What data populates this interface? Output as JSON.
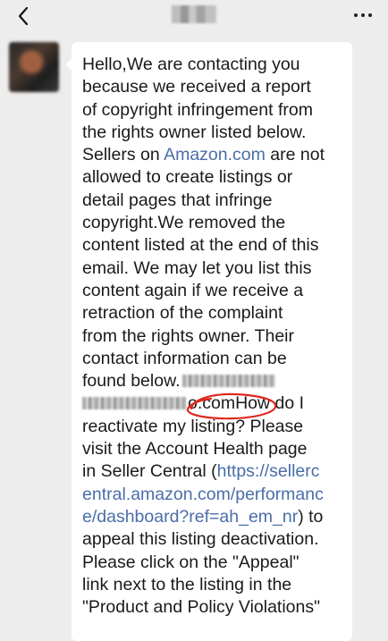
{
  "header": {
    "back_icon": "chevron-left-icon",
    "more_icon": "more-dots-icon"
  },
  "message": {
    "lines": [
      "Hello,We are contacting you",
      "because we received a report",
      "of copyright infringement from",
      "the rights owner listed below.",
      [
        "Sellers on ",
        "Amazon.com",
        " are not"
      ],
      " allowed to create listings or",
      "detail pages that infringe",
      "copyright.We removed the",
      "content listed at the end of this",
      " email. We may let you list this",
      "content again if we receive a",
      "retraction of the complaint",
      "from the rights owner. Their",
      "contact information can be",
      "found below.",
      "o.comHow do I",
      "reactivate my listing? Please",
      "visit the Account Health page",
      [
        "in Seller Central (",
        "https://sellerc"
      ],
      "entral.amazon.com/performanc",
      [
        "e/dashboard?ref=ah_em_nr",
        ") to"
      ],
      " appeal this listing deactivation.",
      " Please click on the \"Appeal\"",
      "link next to the listing in the",
      "\"Product and Policy Violations\""
    ]
  },
  "colors": {
    "background": "#ededed",
    "bubble": "#ffffff",
    "text": "#1a1a1a",
    "link": "#4a6ea8",
    "annotation": "#e0281e"
  }
}
